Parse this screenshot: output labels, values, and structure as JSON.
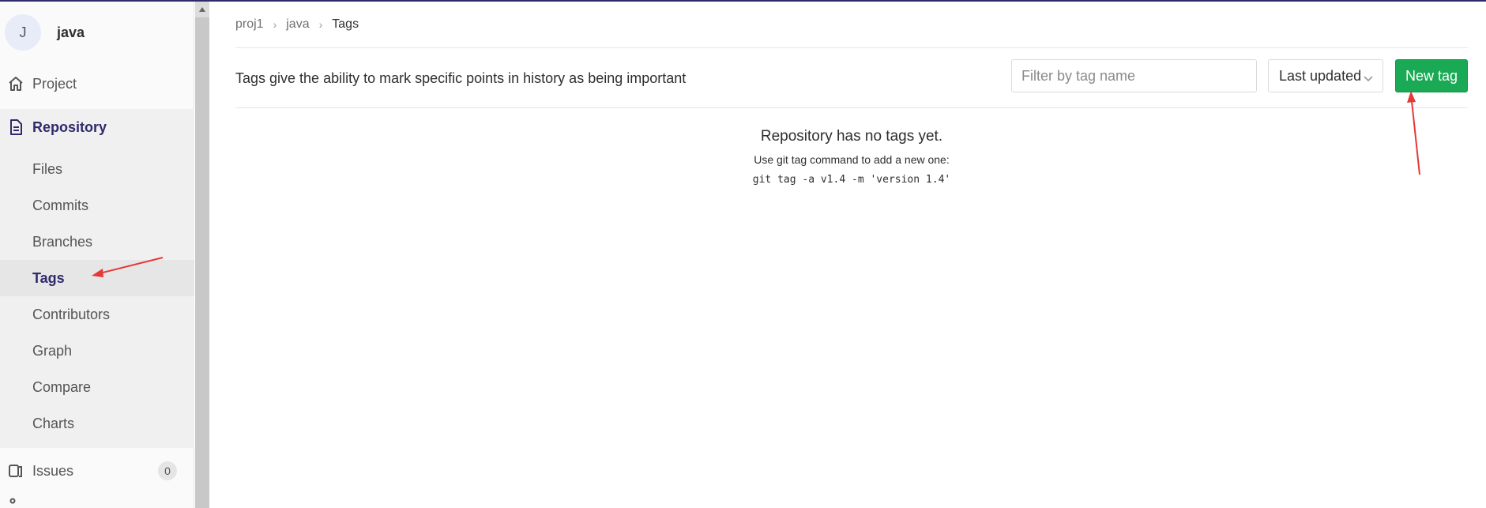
{
  "project": {
    "avatar_letter": "J",
    "name": "java"
  },
  "sidebar": {
    "project_label": "Project",
    "repository_label": "Repository",
    "sub_items": [
      "Files",
      "Commits",
      "Branches",
      "Tags",
      "Contributors",
      "Graph",
      "Compare",
      "Charts"
    ],
    "active_sub_item": "Tags",
    "issues_label": "Issues",
    "issues_count": "0"
  },
  "breadcrumb": {
    "items": [
      "proj1",
      "java",
      "Tags"
    ]
  },
  "header": {
    "description": "Tags give the ability to mark specific points in history as being important",
    "filter_placeholder": "Filter by tag name",
    "sort_value": "Last updated",
    "new_tag_label": "New tag"
  },
  "empty_state": {
    "title": "Repository has no tags yet.",
    "hint": "Use git tag command to add a new one:",
    "command": "git tag -a v1.4 -m 'version 1.4'"
  },
  "colors": {
    "accent": "#2f2a6b",
    "button_green": "#1aaa55",
    "annotation_arrow": "#e53935"
  }
}
